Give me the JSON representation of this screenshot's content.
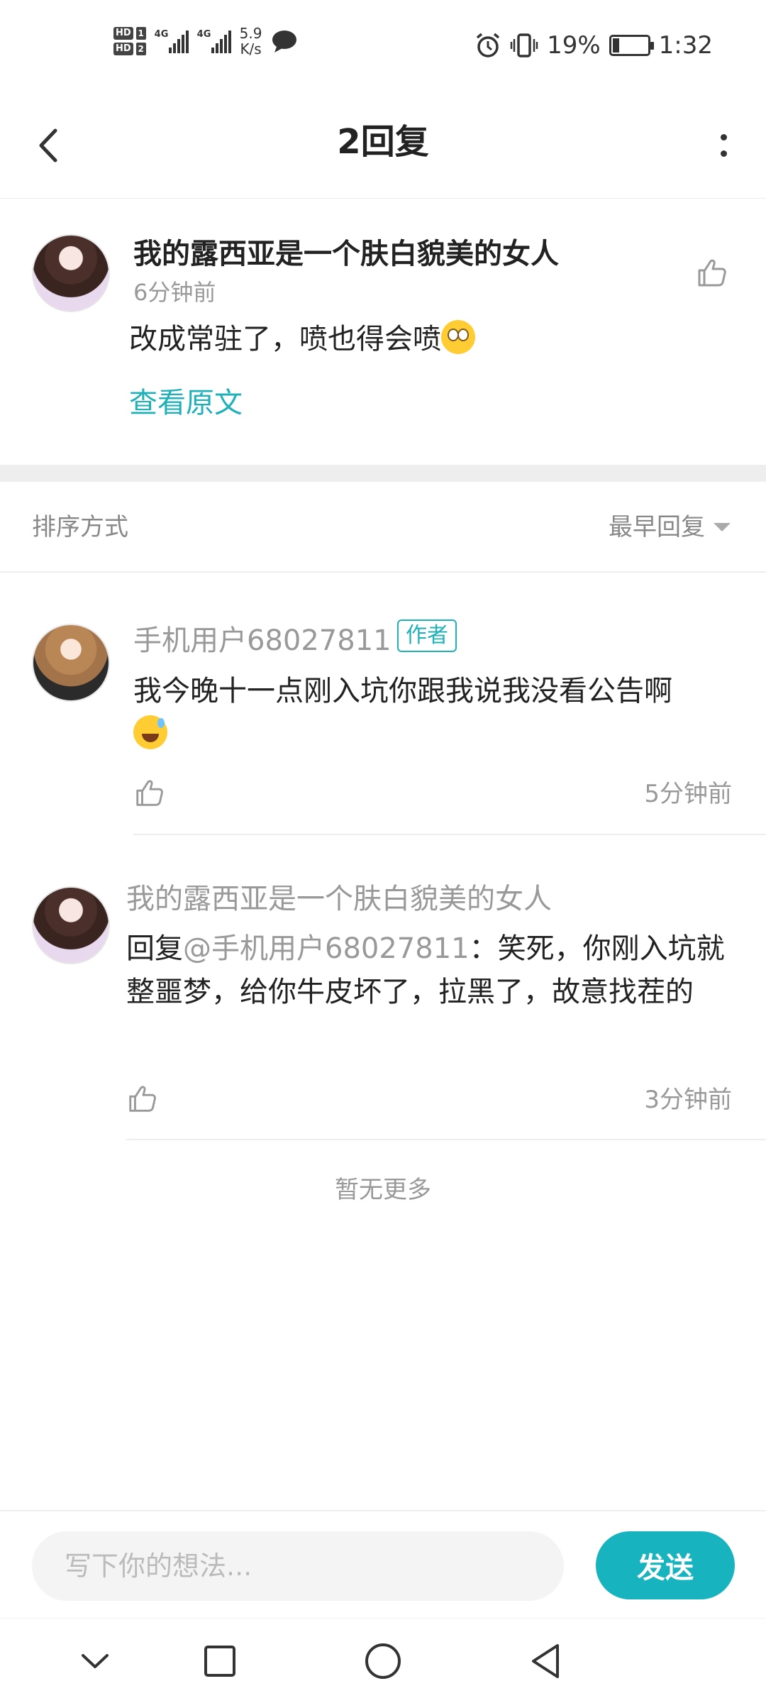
{
  "status_bar": {
    "hd1": "HD",
    "hd1_num": "1",
    "hd2": "HD",
    "hd2_num": "2",
    "net1": "4G",
    "net2": "4G",
    "speed_value": "5.9",
    "speed_unit": "K/s",
    "battery": "19%",
    "battery_level": 0.19,
    "time": "1:32",
    "icons": [
      "message-icon",
      "alarm-icon",
      "vibrate-icon",
      "battery-icon"
    ]
  },
  "header": {
    "title": "2回复",
    "back_icon": "chevron-left-icon",
    "more_icon": "more-vertical-icon"
  },
  "main_comment": {
    "username": "我的露西亚是一个肤白貌美的女人",
    "time": "6分钟前",
    "text": "改成常驻了，喷也得会喷",
    "emoji": "face-with-rolling-eyes",
    "view_original": "查看原文"
  },
  "sort": {
    "label": "排序方式",
    "selected": "最早回复"
  },
  "replies": [
    {
      "username": "手机用户68027811",
      "badge": "作者",
      "text": "我今晚十一点刚入坑你跟我说我没看公告啊",
      "emoji": "grinning-face-with-sweat",
      "time": "5分钟前"
    },
    {
      "username": "我的露西亚是一个肤白貌美的女人",
      "reply_prefix": "回复",
      "mention": "@手机用户68027811",
      "text": "：笑死，你刚入坑就整噩梦，给你牛皮坏了，拉黑了，故意找茬的",
      "time": "3分钟前"
    }
  ],
  "no_more": "暂无更多",
  "input": {
    "placeholder": "写下你的想法...",
    "value": "",
    "send_label": "发送"
  },
  "nav": {
    "icons": [
      "collapse-icon",
      "recents-icon",
      "home-icon",
      "back-icon"
    ]
  },
  "colors": {
    "accent": "#17b3be",
    "link": "#1fb0b8",
    "muted_text": "#999999"
  }
}
